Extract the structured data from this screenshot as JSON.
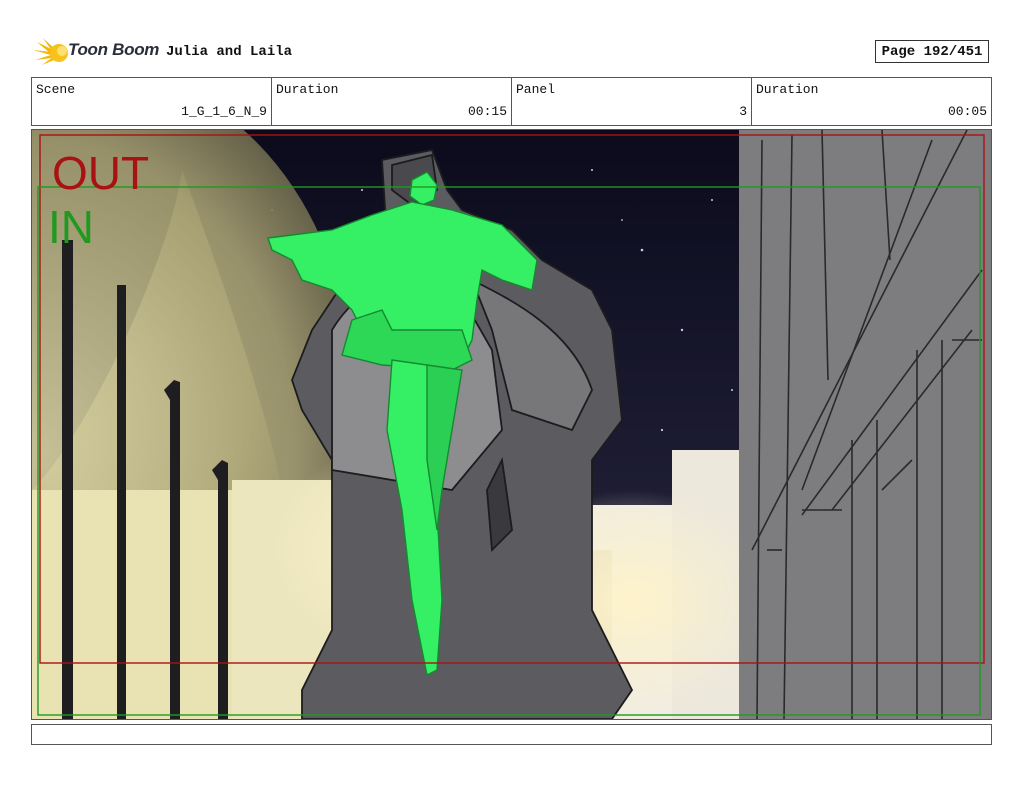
{
  "header": {
    "logo_text": "Toon Boom",
    "project_title": "Julia and Laila",
    "page_label": "Page 192/451"
  },
  "info": {
    "scene_label": "Scene",
    "scene_value": "1_G_1_6_N_9",
    "scene_duration_label": "Duration",
    "scene_duration_value": "00:15",
    "panel_label": "Panel",
    "panel_value": "3",
    "panel_duration_label": "Duration",
    "panel_duration_value": "00:05"
  },
  "panel": {
    "out_label": "OUT",
    "in_label": "IN",
    "colors": {
      "out_frame": "#a81212",
      "in_frame": "#1f9a1f",
      "character": "#35f064"
    }
  },
  "notes": {
    "text": ""
  }
}
